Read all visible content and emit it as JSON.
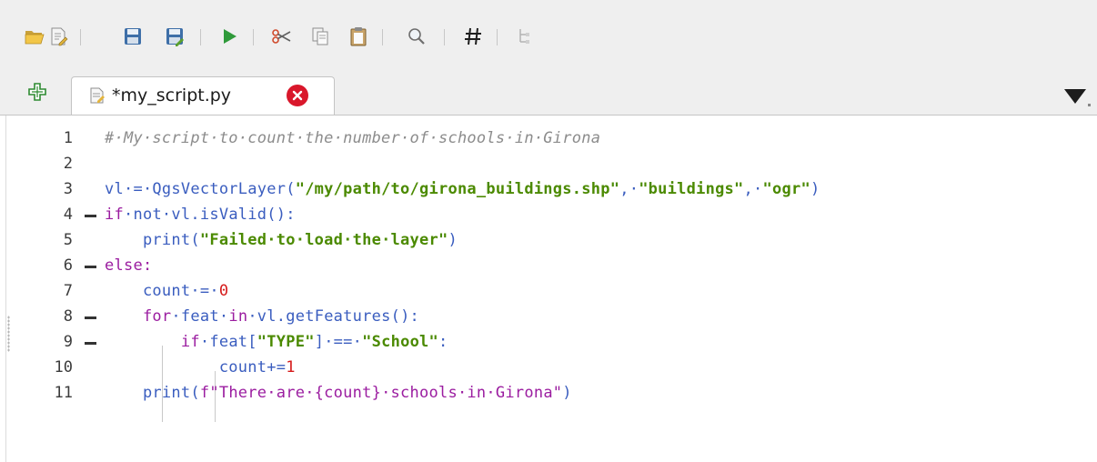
{
  "toolbar": {
    "buttons": [
      {
        "name": "open-script-button",
        "icon": "folder-open-icon"
      },
      {
        "name": "open-in-external-editor-button",
        "icon": "document-edit-icon"
      },
      {
        "name": "save-button",
        "icon": "save-icon"
      },
      {
        "name": "save-as-button",
        "icon": "save-as-icon"
      },
      {
        "name": "run-script-button",
        "icon": "play-icon"
      },
      {
        "name": "cut-button",
        "icon": "scissors-icon"
      },
      {
        "name": "copy-button",
        "icon": "copy-icon"
      },
      {
        "name": "paste-button",
        "icon": "clipboard-icon"
      },
      {
        "name": "find-button",
        "icon": "magnifier-icon"
      },
      {
        "name": "toggle-comment-button",
        "icon": "hash-icon"
      },
      {
        "name": "object-inspector-button",
        "icon": "tree-icon"
      }
    ]
  },
  "tabs": {
    "items": [
      {
        "label": "*my_script.py",
        "active": true,
        "icon": "script-file-icon"
      }
    ],
    "add_icon": "add-tab-icon",
    "menu_icon": "chevron-down-icon"
  },
  "editor": {
    "lines": [
      {
        "n": "1",
        "fold": false
      },
      {
        "n": "2",
        "fold": false
      },
      {
        "n": "3",
        "fold": false
      },
      {
        "n": "4",
        "fold": true
      },
      {
        "n": "5",
        "fold": false
      },
      {
        "n": "6",
        "fold": true
      },
      {
        "n": "7",
        "fold": false
      },
      {
        "n": "8",
        "fold": true
      },
      {
        "n": "9",
        "fold": true
      },
      {
        "n": "10",
        "fold": false
      },
      {
        "n": "11",
        "fold": false
      }
    ],
    "code": {
      "l1": "#·My·script·to·count·the·number·of·schools·in·Girona",
      "l3a": "vl·=·QgsVectorLayer(",
      "l3b": "\"/my/path/to/girona_buildings.shp\"",
      "l3c": ",·",
      "l3d": "\"buildings\"",
      "l3e": ",·",
      "l3f": "\"ogr\"",
      "l3g": ")",
      "l4a": "if",
      "l4b": "·not·vl.isValid():",
      "l5a": "    print(",
      "l5b": "\"Failed·to·load·the·layer\"",
      "l5c": ")",
      "l6": "else:",
      "l7a": "    count·=·",
      "l7b": "0",
      "l8a": "    for",
      "l8b": "·feat·",
      "l8c": "in",
      "l8d": "·vl.getFeatures():",
      "l9a": "        if",
      "l9b": "·feat[",
      "l9c": "\"TYPE\"",
      "l9d": "]·==·",
      "l9e": "\"School\"",
      "l9f": ":",
      "l10a": "            count+=",
      "l10b": "1",
      "l11a": "    print(",
      "l11b": "f\"There·are·{count}·schools·in·Girona\"",
      "l11c": ")"
    }
  },
  "colors": {
    "keyword": "#9b1da0",
    "string": "#4b8a00",
    "identifier": "#3a5dbf",
    "number": "#d51b1b",
    "comment": "#8c8c8c",
    "close_badge": "#d9172b"
  }
}
